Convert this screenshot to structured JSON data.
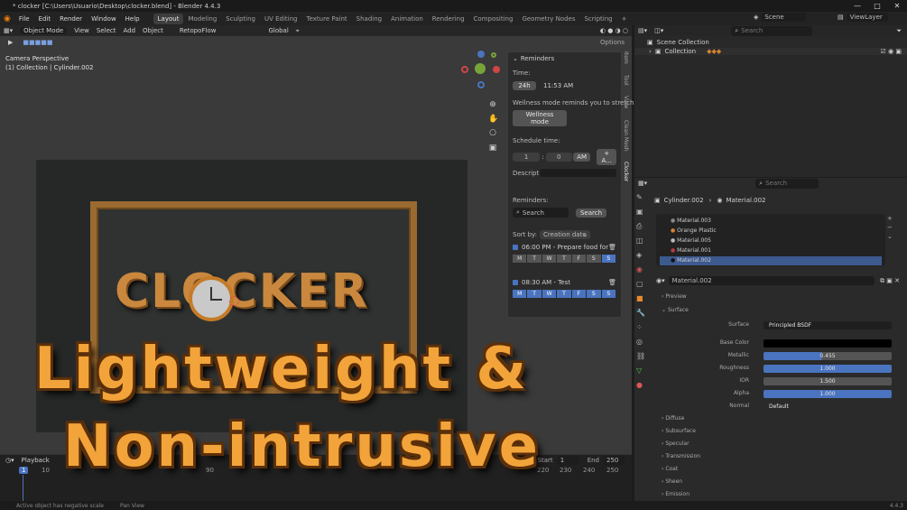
{
  "window": {
    "title": "* clocker [C:\\Users\\Usuario\\Desktop\\clocker.blend] - Blender 4.4.3",
    "controls": [
      "—",
      "□",
      "✕"
    ]
  },
  "menu": {
    "items": [
      "File",
      "Edit",
      "Render",
      "Window",
      "Help"
    ]
  },
  "workspaces": [
    {
      "label": "Layout",
      "active": true
    },
    {
      "label": "Modeling"
    },
    {
      "label": "Sculpting"
    },
    {
      "label": "UV Editing"
    },
    {
      "label": "Texture Paint"
    },
    {
      "label": "Shading"
    },
    {
      "label": "Animation"
    },
    {
      "label": "Rendering"
    },
    {
      "label": "Compositing"
    },
    {
      "label": "Geometry Nodes"
    },
    {
      "label": "Scripting"
    }
  ],
  "topright": {
    "scene": "Scene",
    "viewlayer": "ViewLayer"
  },
  "viewport": {
    "mode": "Object Mode",
    "menus": [
      "View",
      "Select",
      "Add",
      "Object"
    ],
    "addon": "RetopoFlow",
    "transform": "Global",
    "options": "Options",
    "overlay_line1": "Camera Perspective",
    "overlay_line2": "(1) Collection | Cylinder.002",
    "scene_text": "CLOCKER",
    "promo_line1": "Lightweight &",
    "promo_line2": "Non-intrusive"
  },
  "reminders": {
    "header": "Reminders",
    "time_label": "Time:",
    "format_btn": "24h",
    "current_time": "11:53 AM",
    "wellness_text": "Wellness mode reminds you to stretch f...",
    "wellness_btn": "Wellness mode",
    "schedule_label": "Schedule time:",
    "hour": "1",
    "minute": "0",
    "ampm": "AM",
    "add_btn": "+ A...",
    "desc_label": "Descript...",
    "list_label": "Reminders:",
    "search_placeholder": "Search",
    "search_btn": "Search",
    "sort_label": "Sort by:",
    "sort_value": "Creation date",
    "items": [
      {
        "text": "06:00 PM - Prepare food for the ...",
        "days": [
          "M",
          "T",
          "W",
          "T",
          "F",
          "S",
          "S"
        ]
      },
      {
        "text": "08:30 AM - Test",
        "days": [
          "M",
          "T",
          "W",
          "T",
          "F",
          "S",
          "S"
        ]
      }
    ]
  },
  "sidetabs": [
    "Item",
    "Tool",
    "View",
    "Clean Mesh",
    "Clocker"
  ],
  "timeline": {
    "playback": "Playback",
    "current_frame": "1",
    "start_label": "Start",
    "start": "1",
    "end_label": "End",
    "end": "250",
    "ticks": [
      "10",
      "90",
      "220",
      "230",
      "240",
      "250"
    ]
  },
  "status": {
    "left": "Active object has negative scale",
    "mid": "Pan View",
    "version": "4.4.3"
  },
  "outliner": {
    "root": "Scene Collection",
    "collection": "Collection",
    "search_placeholder": "Search"
  },
  "properties": {
    "object": "Cylinder.002",
    "material": "Material.002",
    "search_placeholder": "Search",
    "slots": [
      "Material.003",
      "Orange Plastic",
      "Material.005",
      "Material.001",
      "Material.002"
    ],
    "slot_dot_colors": [
      "#888888",
      "#d4822e",
      "#bbbbbb",
      "#b83a3a",
      "#2a2a2a"
    ],
    "material_field": "Material.002",
    "preview": "Preview",
    "surface": "Surface",
    "surface_row": {
      "label": "Surface",
      "value": "Principled BSDF"
    },
    "rows": [
      {
        "label": "Base Color",
        "value": "",
        "fill": 0
      },
      {
        "label": "Metallic",
        "value": "0.455",
        "fill": 0.455
      },
      {
        "label": "Roughness",
        "value": "1.000",
        "fill": 1
      },
      {
        "label": "IOR",
        "value": "1.500",
        "fill": 1
      },
      {
        "label": "Alpha",
        "value": "1.000",
        "fill": 1
      }
    ],
    "normal": {
      "label": "Normal",
      "value": "Default"
    },
    "sections": [
      "Diffuse",
      "Subsurface",
      "Specular",
      "Transmission",
      "Coat",
      "Sheen",
      "Emission"
    ]
  },
  "colors": {
    "accent": "#4a74c0",
    "wood": "#9a6a30",
    "promo": "#f2a43a"
  }
}
